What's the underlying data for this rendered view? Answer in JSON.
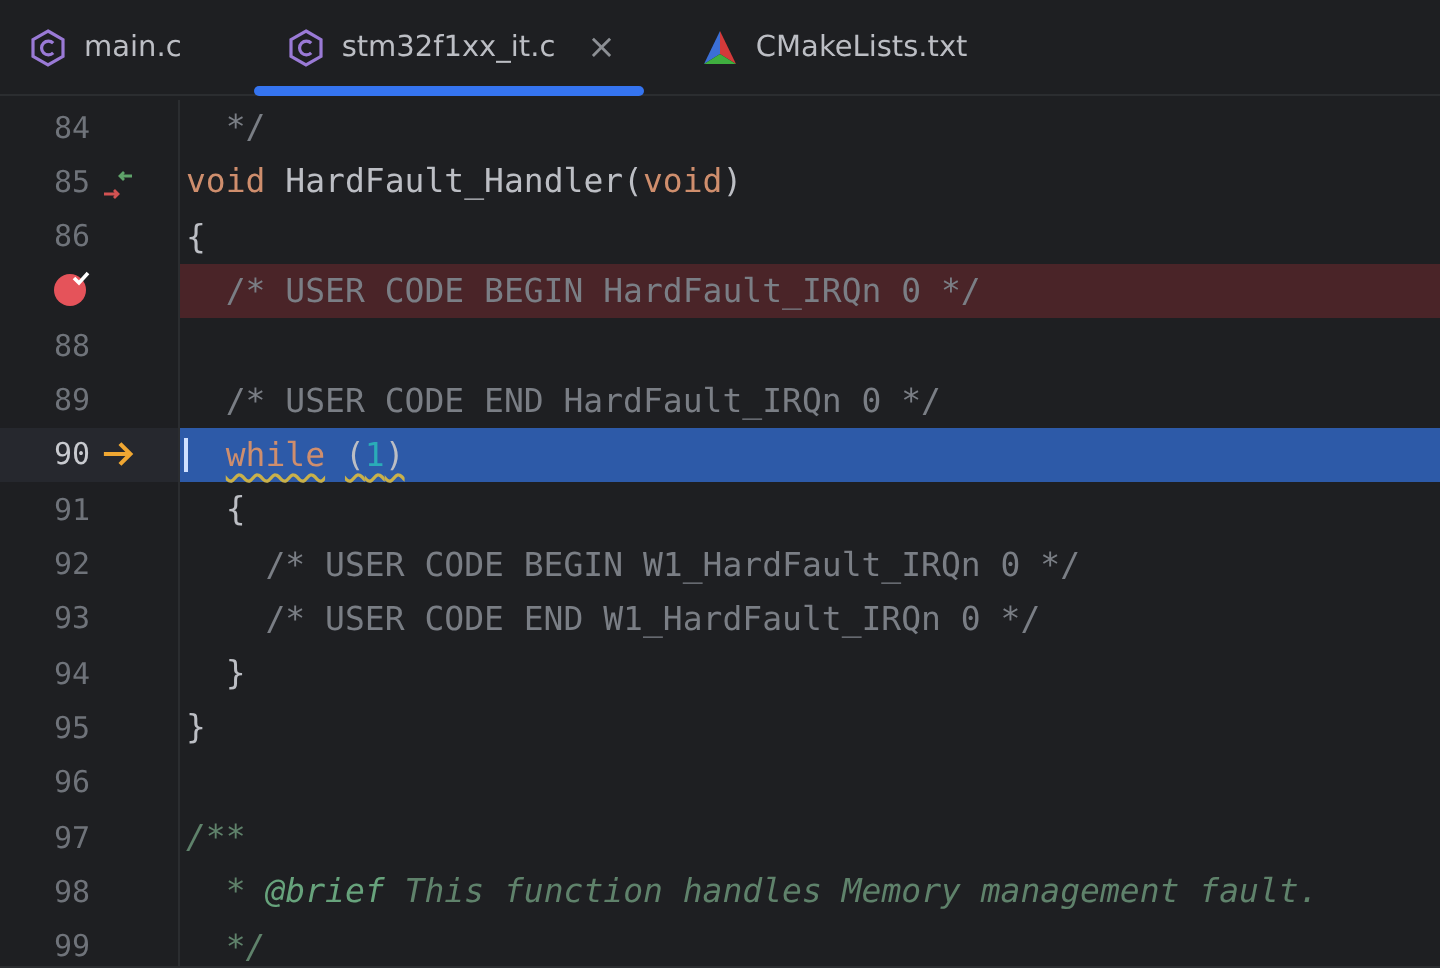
{
  "tabs": [
    {
      "label": "main.c",
      "kind": "c",
      "selected": false
    },
    {
      "label": "stm32f1xx_it.c",
      "kind": "c",
      "selected": true,
      "close": "×"
    },
    {
      "label": "CMakeLists.txt",
      "kind": "cmake",
      "selected": false
    }
  ],
  "lines": [
    {
      "number": "84",
      "tokens": [
        {
          "text": "  */",
          "kind": "comment"
        }
      ]
    },
    {
      "number": "85",
      "kind": "override",
      "tokens": [
        {
          "text": "void",
          "kind": "keyword"
        },
        {
          "text": " HardFault_Handler(",
          "kind": "plain"
        },
        {
          "text": "void",
          "kind": "keyword"
        },
        {
          "text": ")",
          "kind": "plain"
        }
      ]
    },
    {
      "number": "86",
      "tokens": [
        {
          "text": "{",
          "kind": "plain"
        }
      ]
    },
    {
      "kind": "breakpoint",
      "tokens": [
        {
          "text": "  /* USER CODE BEGIN HardFault_IRQn 0 */",
          "kind": "comment"
        }
      ]
    },
    {
      "number": "88"
    },
    {
      "number": "89",
      "tokens": [
        {
          "text": "  /* USER CODE END HardFault_IRQn 0 */",
          "kind": "comment"
        }
      ]
    },
    {
      "number": "90",
      "kind": "execution",
      "tokens": [
        {
          "text": "  while",
          "kind": "keyword",
          "warning": true
        },
        {
          "text": " (",
          "kind": "plain",
          "warning": true
        },
        {
          "text": "1",
          "kind": "number",
          "warning": true
        },
        {
          "text": ")",
          "kind": "plain",
          "warning": true
        }
      ]
    },
    {
      "number": "91",
      "tokens": [
        {
          "text": "  {",
          "kind": "plain"
        }
      ]
    },
    {
      "number": "92",
      "tokens": [
        {
          "text": "    /* USER CODE BEGIN W1_HardFault_IRQn 0 */",
          "kind": "comment"
        }
      ]
    },
    {
      "number": "93",
      "tokens": [
        {
          "text": "    /* USER CODE END W1_HardFault_IRQn 0 */",
          "kind": "comment"
        }
      ]
    },
    {
      "number": "94",
      "tokens": [
        {
          "text": "  }",
          "kind": "plain"
        }
      ]
    },
    {
      "number": "95",
      "tokens": [
        {
          "text": "}",
          "kind": "plain"
        }
      ]
    },
    {
      "number": "96"
    },
    {
      "number": "97",
      "tokens": [
        {
          "text": "/**",
          "kind": "doc"
        }
      ]
    },
    {
      "number": "98",
      "tokens": [
        {
          "text": "  * ",
          "kind": "doc"
        },
        {
          "text": "@brief",
          "kind": "doctag"
        },
        {
          "text": " This function handles Memory management fault.",
          "kind": "doc"
        }
      ]
    },
    {
      "number": "99",
      "tokens": [
        {
          "text": "  */",
          "kind": "doc"
        }
      ]
    }
  ]
}
